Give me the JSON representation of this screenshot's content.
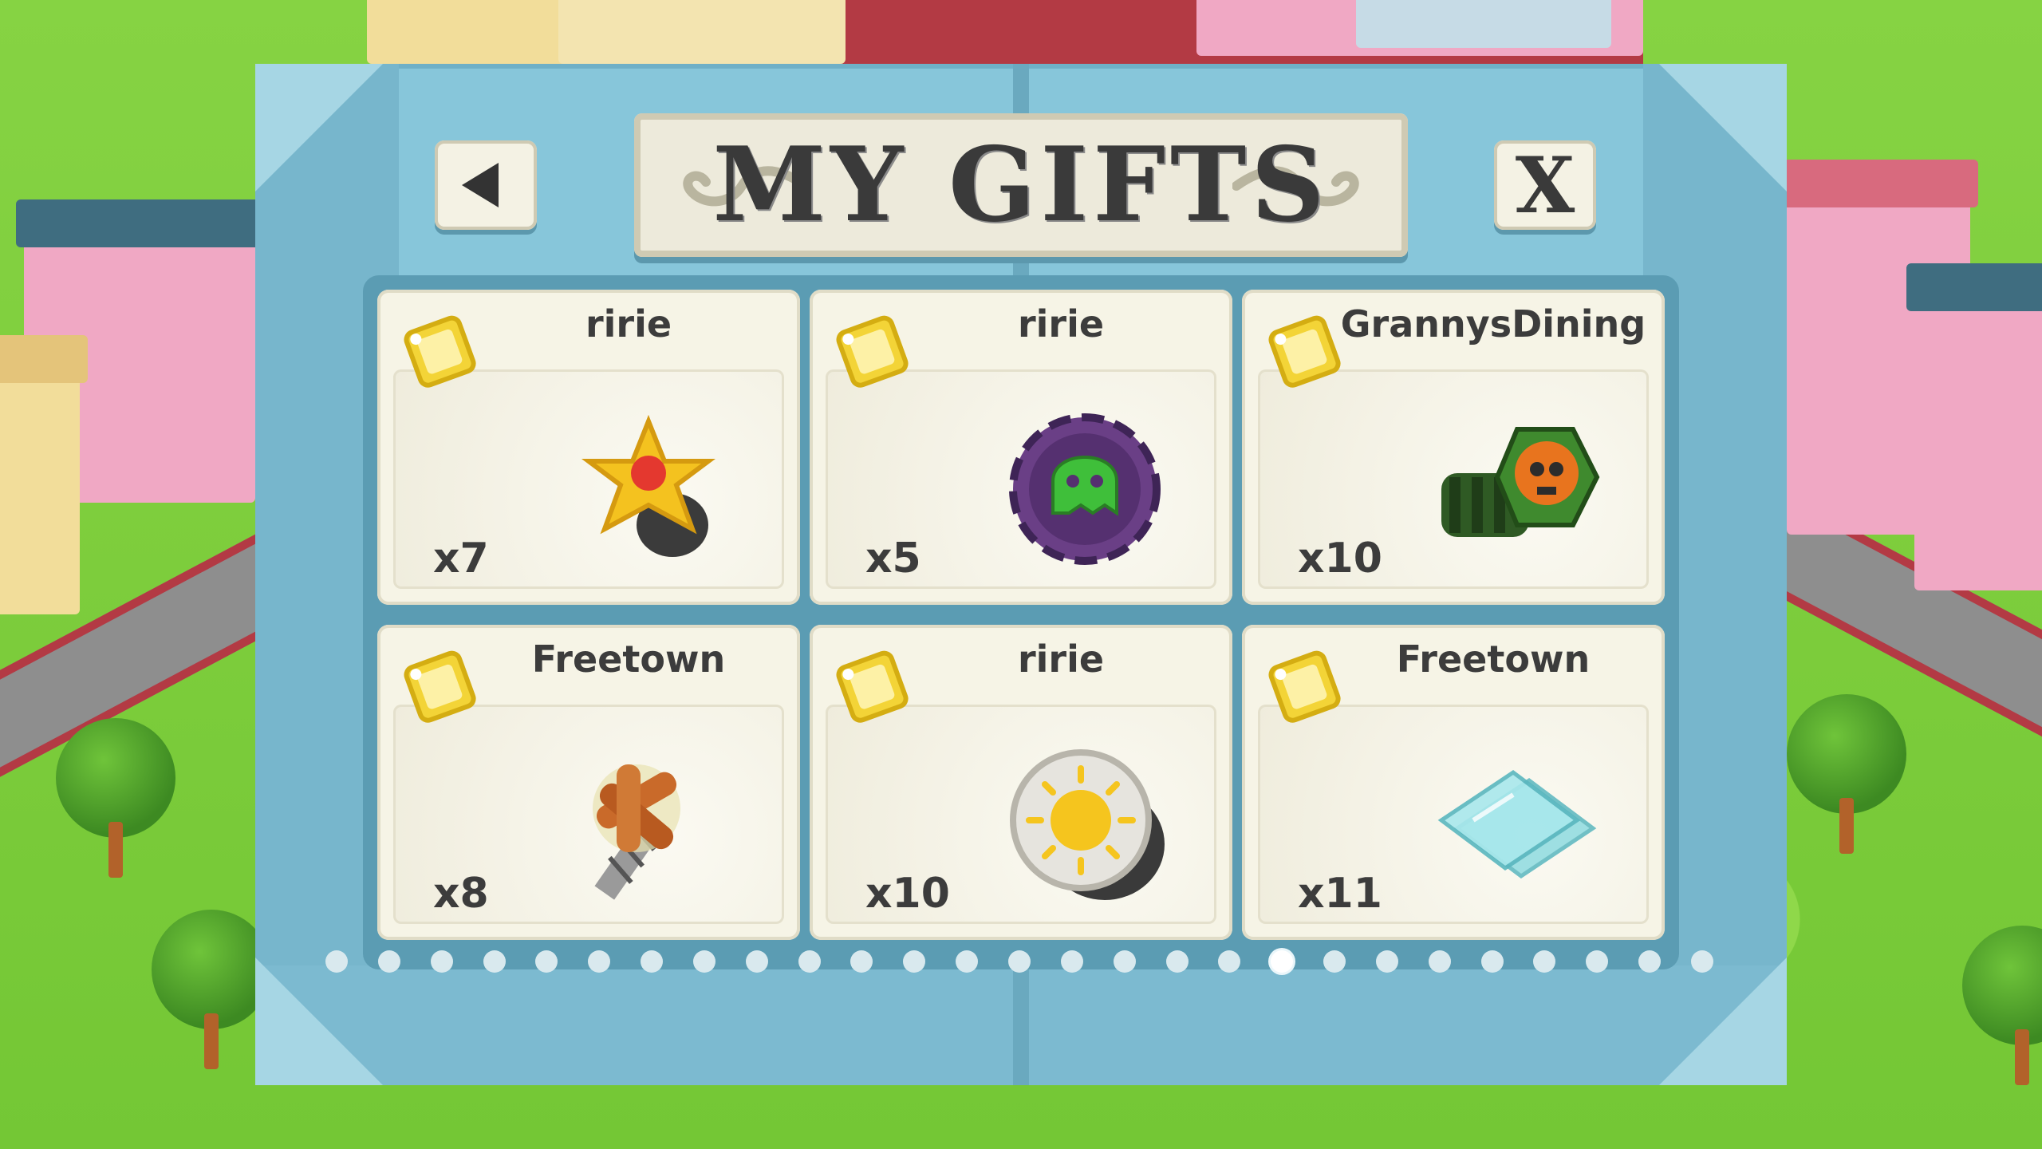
{
  "header": {
    "title": "MY GIFTS",
    "back_icon": "triangle-left-icon",
    "close_label": "X"
  },
  "gifts": [
    {
      "sender": "ririe",
      "count": "x7",
      "item_icon": "golden-star-bolt-icon"
    },
    {
      "sender": "ririe",
      "count": "x5",
      "item_icon": "purple-gear-ghost-icon"
    },
    {
      "sender": "GrannysDining",
      "count": "x10",
      "item_icon": "green-skull-bolt-icon"
    },
    {
      "sender": "Freetown",
      "count": "x8",
      "item_icon": "cinnamon-screw-icon"
    },
    {
      "sender": "ririe",
      "count": "x10",
      "item_icon": "sun-knob-icon"
    },
    {
      "sender": "Freetown",
      "count": "x11",
      "item_icon": "glass-panes-icon"
    }
  ],
  "pagination": {
    "total": 27,
    "active_index": 18
  },
  "colors": {
    "panel": "#87c6da",
    "card": "#f6f4e6",
    "text": "#3c3c3c"
  }
}
